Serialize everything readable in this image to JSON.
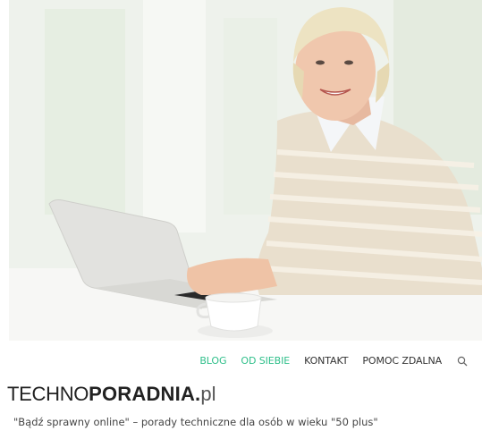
{
  "hero": {
    "image": "woman-with-laptop-photo"
  },
  "nav": {
    "items": [
      {
        "label": "BLOG",
        "active": true
      },
      {
        "label": "OD SIEBIE",
        "active": true
      },
      {
        "label": "KONTAKT",
        "active": false
      },
      {
        "label": "POMOC ZDALNA",
        "active": false
      }
    ],
    "search_icon": "search-icon"
  },
  "logo": {
    "part1": "TECHNO",
    "part2": "PORADNIA.",
    "part3": "pl"
  },
  "tagline": "\"Bądź sprawny online\" – porady techniczne dla osób w wieku \"50 plus\"",
  "colors": {
    "accent": "#2fbf8a",
    "text": "#333333",
    "background": "#ffffff"
  }
}
